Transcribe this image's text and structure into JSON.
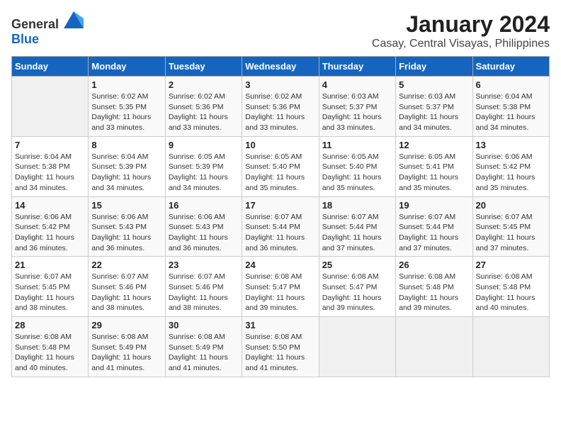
{
  "logo": {
    "text_general": "General",
    "text_blue": "Blue"
  },
  "title": "January 2024",
  "subtitle": "Casay, Central Visayas, Philippines",
  "days_of_week": [
    "Sunday",
    "Monday",
    "Tuesday",
    "Wednesday",
    "Thursday",
    "Friday",
    "Saturday"
  ],
  "weeks": [
    [
      {
        "day": "",
        "sunrise": "",
        "sunset": "",
        "daylight": ""
      },
      {
        "day": "1",
        "sunrise": "Sunrise: 6:02 AM",
        "sunset": "Sunset: 5:35 PM",
        "daylight": "Daylight: 11 hours and 33 minutes."
      },
      {
        "day": "2",
        "sunrise": "Sunrise: 6:02 AM",
        "sunset": "Sunset: 5:36 PM",
        "daylight": "Daylight: 11 hours and 33 minutes."
      },
      {
        "day": "3",
        "sunrise": "Sunrise: 6:02 AM",
        "sunset": "Sunset: 5:36 PM",
        "daylight": "Daylight: 11 hours and 33 minutes."
      },
      {
        "day": "4",
        "sunrise": "Sunrise: 6:03 AM",
        "sunset": "Sunset: 5:37 PM",
        "daylight": "Daylight: 11 hours and 33 minutes."
      },
      {
        "day": "5",
        "sunrise": "Sunrise: 6:03 AM",
        "sunset": "Sunset: 5:37 PM",
        "daylight": "Daylight: 11 hours and 34 minutes."
      },
      {
        "day": "6",
        "sunrise": "Sunrise: 6:04 AM",
        "sunset": "Sunset: 5:38 PM",
        "daylight": "Daylight: 11 hours and 34 minutes."
      }
    ],
    [
      {
        "day": "7",
        "sunrise": "Sunrise: 6:04 AM",
        "sunset": "Sunset: 5:38 PM",
        "daylight": "Daylight: 11 hours and 34 minutes."
      },
      {
        "day": "8",
        "sunrise": "Sunrise: 6:04 AM",
        "sunset": "Sunset: 5:39 PM",
        "daylight": "Daylight: 11 hours and 34 minutes."
      },
      {
        "day": "9",
        "sunrise": "Sunrise: 6:05 AM",
        "sunset": "Sunset: 5:39 PM",
        "daylight": "Daylight: 11 hours and 34 minutes."
      },
      {
        "day": "10",
        "sunrise": "Sunrise: 6:05 AM",
        "sunset": "Sunset: 5:40 PM",
        "daylight": "Daylight: 11 hours and 35 minutes."
      },
      {
        "day": "11",
        "sunrise": "Sunrise: 6:05 AM",
        "sunset": "Sunset: 5:40 PM",
        "daylight": "Daylight: 11 hours and 35 minutes."
      },
      {
        "day": "12",
        "sunrise": "Sunrise: 6:05 AM",
        "sunset": "Sunset: 5:41 PM",
        "daylight": "Daylight: 11 hours and 35 minutes."
      },
      {
        "day": "13",
        "sunrise": "Sunrise: 6:06 AM",
        "sunset": "Sunset: 5:42 PM",
        "daylight": "Daylight: 11 hours and 35 minutes."
      }
    ],
    [
      {
        "day": "14",
        "sunrise": "Sunrise: 6:06 AM",
        "sunset": "Sunset: 5:42 PM",
        "daylight": "Daylight: 11 hours and 36 minutes."
      },
      {
        "day": "15",
        "sunrise": "Sunrise: 6:06 AM",
        "sunset": "Sunset: 5:43 PM",
        "daylight": "Daylight: 11 hours and 36 minutes."
      },
      {
        "day": "16",
        "sunrise": "Sunrise: 6:06 AM",
        "sunset": "Sunset: 5:43 PM",
        "daylight": "Daylight: 11 hours and 36 minutes."
      },
      {
        "day": "17",
        "sunrise": "Sunrise: 6:07 AM",
        "sunset": "Sunset: 5:44 PM",
        "daylight": "Daylight: 11 hours and 36 minutes."
      },
      {
        "day": "18",
        "sunrise": "Sunrise: 6:07 AM",
        "sunset": "Sunset: 5:44 PM",
        "daylight": "Daylight: 11 hours and 37 minutes."
      },
      {
        "day": "19",
        "sunrise": "Sunrise: 6:07 AM",
        "sunset": "Sunset: 5:44 PM",
        "daylight": "Daylight: 11 hours and 37 minutes."
      },
      {
        "day": "20",
        "sunrise": "Sunrise: 6:07 AM",
        "sunset": "Sunset: 5:45 PM",
        "daylight": "Daylight: 11 hours and 37 minutes."
      }
    ],
    [
      {
        "day": "21",
        "sunrise": "Sunrise: 6:07 AM",
        "sunset": "Sunset: 5:45 PM",
        "daylight": "Daylight: 11 hours and 38 minutes."
      },
      {
        "day": "22",
        "sunrise": "Sunrise: 6:07 AM",
        "sunset": "Sunset: 5:46 PM",
        "daylight": "Daylight: 11 hours and 38 minutes."
      },
      {
        "day": "23",
        "sunrise": "Sunrise: 6:07 AM",
        "sunset": "Sunset: 5:46 PM",
        "daylight": "Daylight: 11 hours and 38 minutes."
      },
      {
        "day": "24",
        "sunrise": "Sunrise: 6:08 AM",
        "sunset": "Sunset: 5:47 PM",
        "daylight": "Daylight: 11 hours and 39 minutes."
      },
      {
        "day": "25",
        "sunrise": "Sunrise: 6:08 AM",
        "sunset": "Sunset: 5:47 PM",
        "daylight": "Daylight: 11 hours and 39 minutes."
      },
      {
        "day": "26",
        "sunrise": "Sunrise: 6:08 AM",
        "sunset": "Sunset: 5:48 PM",
        "daylight": "Daylight: 11 hours and 39 minutes."
      },
      {
        "day": "27",
        "sunrise": "Sunrise: 6:08 AM",
        "sunset": "Sunset: 5:48 PM",
        "daylight": "Daylight: 11 hours and 40 minutes."
      }
    ],
    [
      {
        "day": "28",
        "sunrise": "Sunrise: 6:08 AM",
        "sunset": "Sunset: 5:48 PM",
        "daylight": "Daylight: 11 hours and 40 minutes."
      },
      {
        "day": "29",
        "sunrise": "Sunrise: 6:08 AM",
        "sunset": "Sunset: 5:49 PM",
        "daylight": "Daylight: 11 hours and 41 minutes."
      },
      {
        "day": "30",
        "sunrise": "Sunrise: 6:08 AM",
        "sunset": "Sunset: 5:49 PM",
        "daylight": "Daylight: 11 hours and 41 minutes."
      },
      {
        "day": "31",
        "sunrise": "Sunrise: 6:08 AM",
        "sunset": "Sunset: 5:50 PM",
        "daylight": "Daylight: 11 hours and 41 minutes."
      },
      {
        "day": "",
        "sunrise": "",
        "sunset": "",
        "daylight": ""
      },
      {
        "day": "",
        "sunrise": "",
        "sunset": "",
        "daylight": ""
      },
      {
        "day": "",
        "sunrise": "",
        "sunset": "",
        "daylight": ""
      }
    ]
  ]
}
